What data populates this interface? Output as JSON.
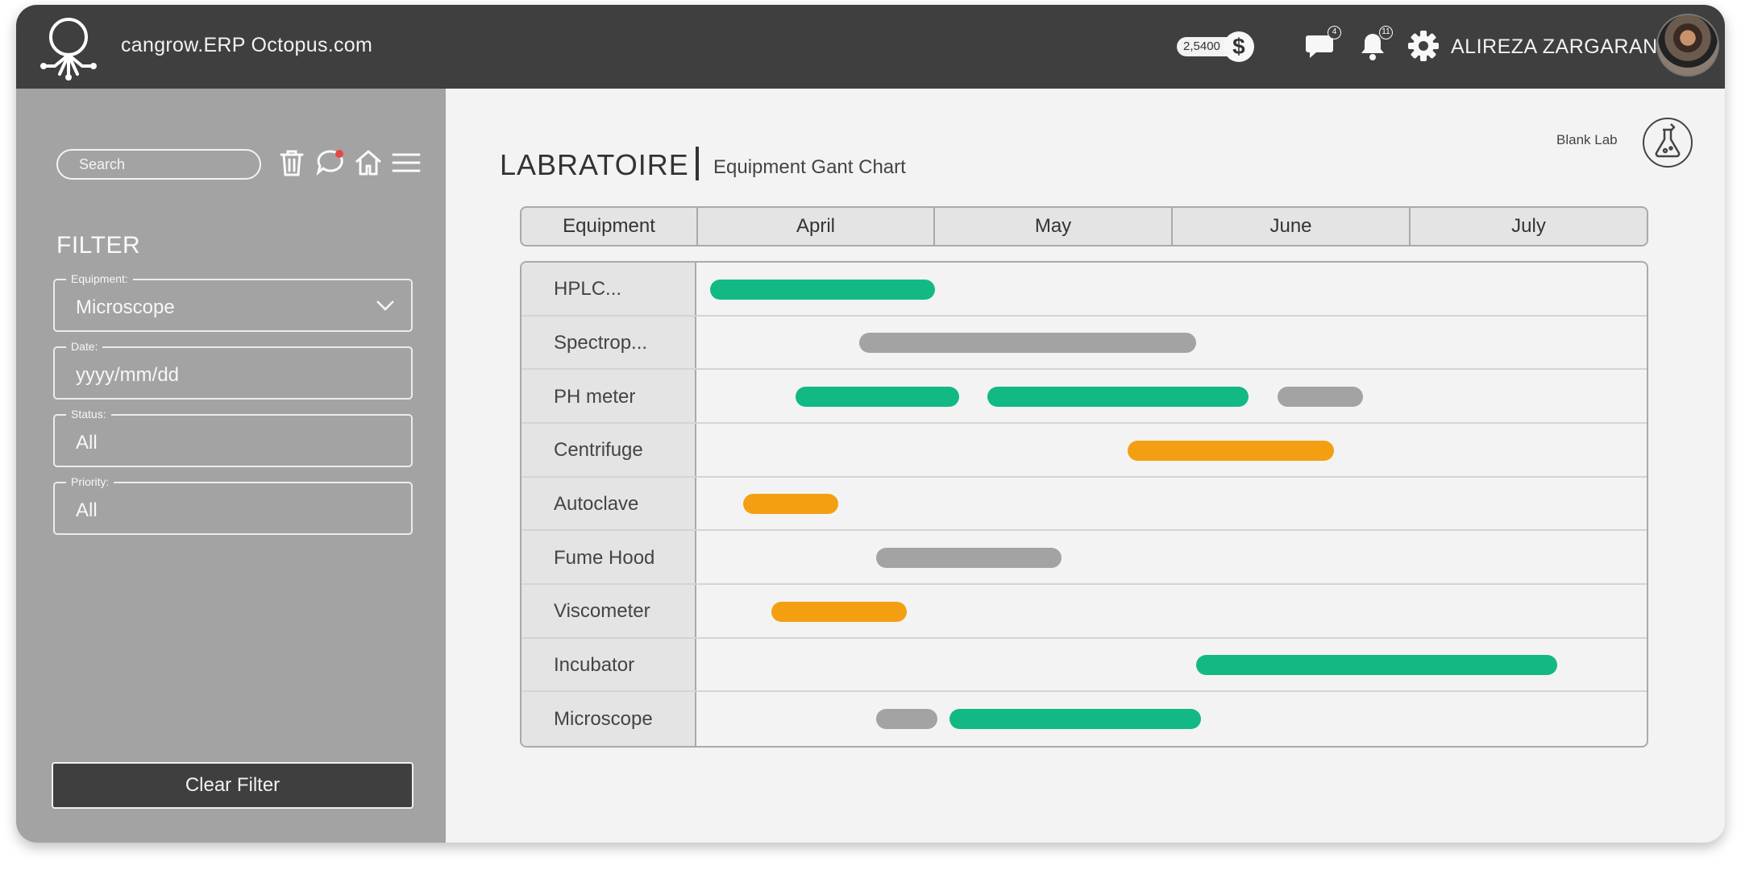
{
  "topbar": {
    "site_title": "cangrow.ERP Octopus.com",
    "balance": "2,5400",
    "currency_symbol": "$",
    "messages_count": "4",
    "notifications_count": "11",
    "username": "ALIREZA ZARGARANI"
  },
  "sidebar": {
    "search_placeholder": "Search",
    "filter_title": "FILTER",
    "fields": [
      {
        "label": "Equipment:",
        "value": "Microscope"
      },
      {
        "label": "Date:",
        "value": "yyyy/mm/dd"
      },
      {
        "label": "Status:",
        "value": "All"
      },
      {
        "label": "Priority:",
        "value": "All"
      }
    ],
    "clear_button": "Clear Filter"
  },
  "main": {
    "title": "LABRATOIRE",
    "subtitle": "Equipment Gant Chart",
    "lab_label": "Blank Lab"
  },
  "colors": {
    "green": "#12b985",
    "gray": "#a3a3a3",
    "orange": "#f49f12"
  },
  "chart_data": {
    "type": "gantt",
    "header_label": "Equipment",
    "months": [
      "April",
      "May",
      "June",
      "July"
    ],
    "rows": [
      {
        "name": "HPLC...",
        "bars": [
          {
            "start": 0.05,
            "end": 1.0,
            "status": "green"
          }
        ]
      },
      {
        "name": "Spectrop...",
        "bars": [
          {
            "start": 0.68,
            "end": 2.1,
            "status": "gray"
          }
        ]
      },
      {
        "name": "PH meter",
        "bars": [
          {
            "start": 0.41,
            "end": 1.1,
            "status": "green"
          },
          {
            "start": 1.22,
            "end": 2.32,
            "status": "green"
          },
          {
            "start": 2.44,
            "end": 2.8,
            "status": "gray"
          }
        ]
      },
      {
        "name": "Centrifuge",
        "bars": [
          {
            "start": 1.81,
            "end": 2.68,
            "status": "orange"
          }
        ]
      },
      {
        "name": "Autoclave",
        "bars": [
          {
            "start": 0.19,
            "end": 0.59,
            "status": "orange"
          }
        ]
      },
      {
        "name": "Fume Hood",
        "bars": [
          {
            "start": 0.75,
            "end": 1.53,
            "status": "gray"
          }
        ]
      },
      {
        "name": "Viscometer",
        "bars": [
          {
            "start": 0.31,
            "end": 0.88,
            "status": "orange"
          }
        ]
      },
      {
        "name": "Incubator",
        "bars": [
          {
            "start": 2.1,
            "end": 3.62,
            "status": "green"
          }
        ]
      },
      {
        "name": "Microscope",
        "bars": [
          {
            "start": 0.75,
            "end": 1.01,
            "status": "gray"
          },
          {
            "start": 1.06,
            "end": 2.12,
            "status": "green"
          }
        ]
      }
    ]
  }
}
